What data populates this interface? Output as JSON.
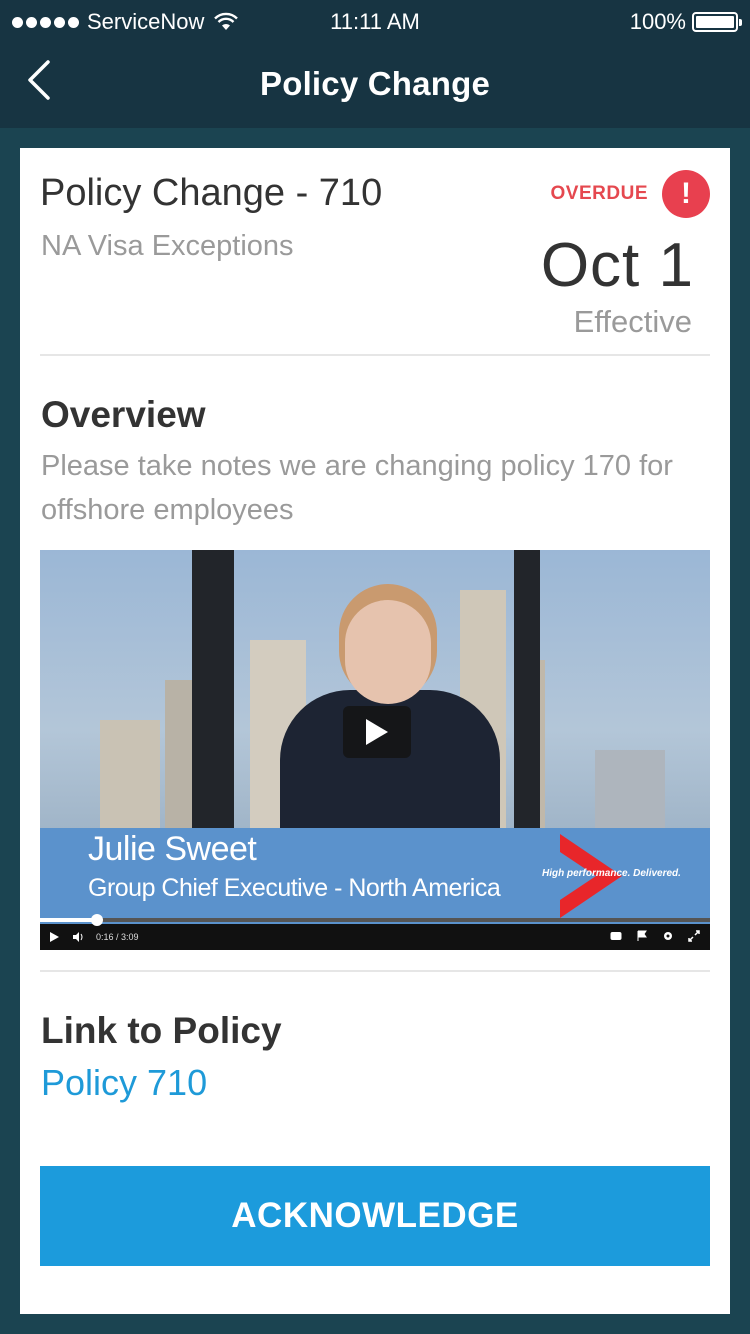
{
  "status_bar": {
    "carrier": "ServiceNow",
    "time": "11:11 AM",
    "battery": "100%"
  },
  "nav": {
    "title": "Policy Change"
  },
  "policy": {
    "title": "Policy Change - 710",
    "subtitle": "NA Visa Exceptions",
    "status": "OVERDUE",
    "effective_date": "Oct 1",
    "effective_label": "Effective"
  },
  "overview": {
    "heading": "Overview",
    "text": "Please take notes we are changing policy 170 for offshore employees"
  },
  "video": {
    "speaker_name": "Julie Sweet",
    "speaker_title": "Group Chief Executive - North America",
    "brand_tagline": "High performance. Delivered.",
    "elapsed": "0:16",
    "duration": "3:09",
    "progress": 0.085
  },
  "link_section": {
    "heading": "Link to Policy",
    "link_text": "Policy 710"
  },
  "actions": {
    "acknowledge_label": "ACKNOWLEDGE"
  },
  "colors": {
    "nav_bg": "#173442",
    "page_bg": "#1b4451",
    "accent": "#1c9bdc",
    "overdue": "#e8404f"
  }
}
